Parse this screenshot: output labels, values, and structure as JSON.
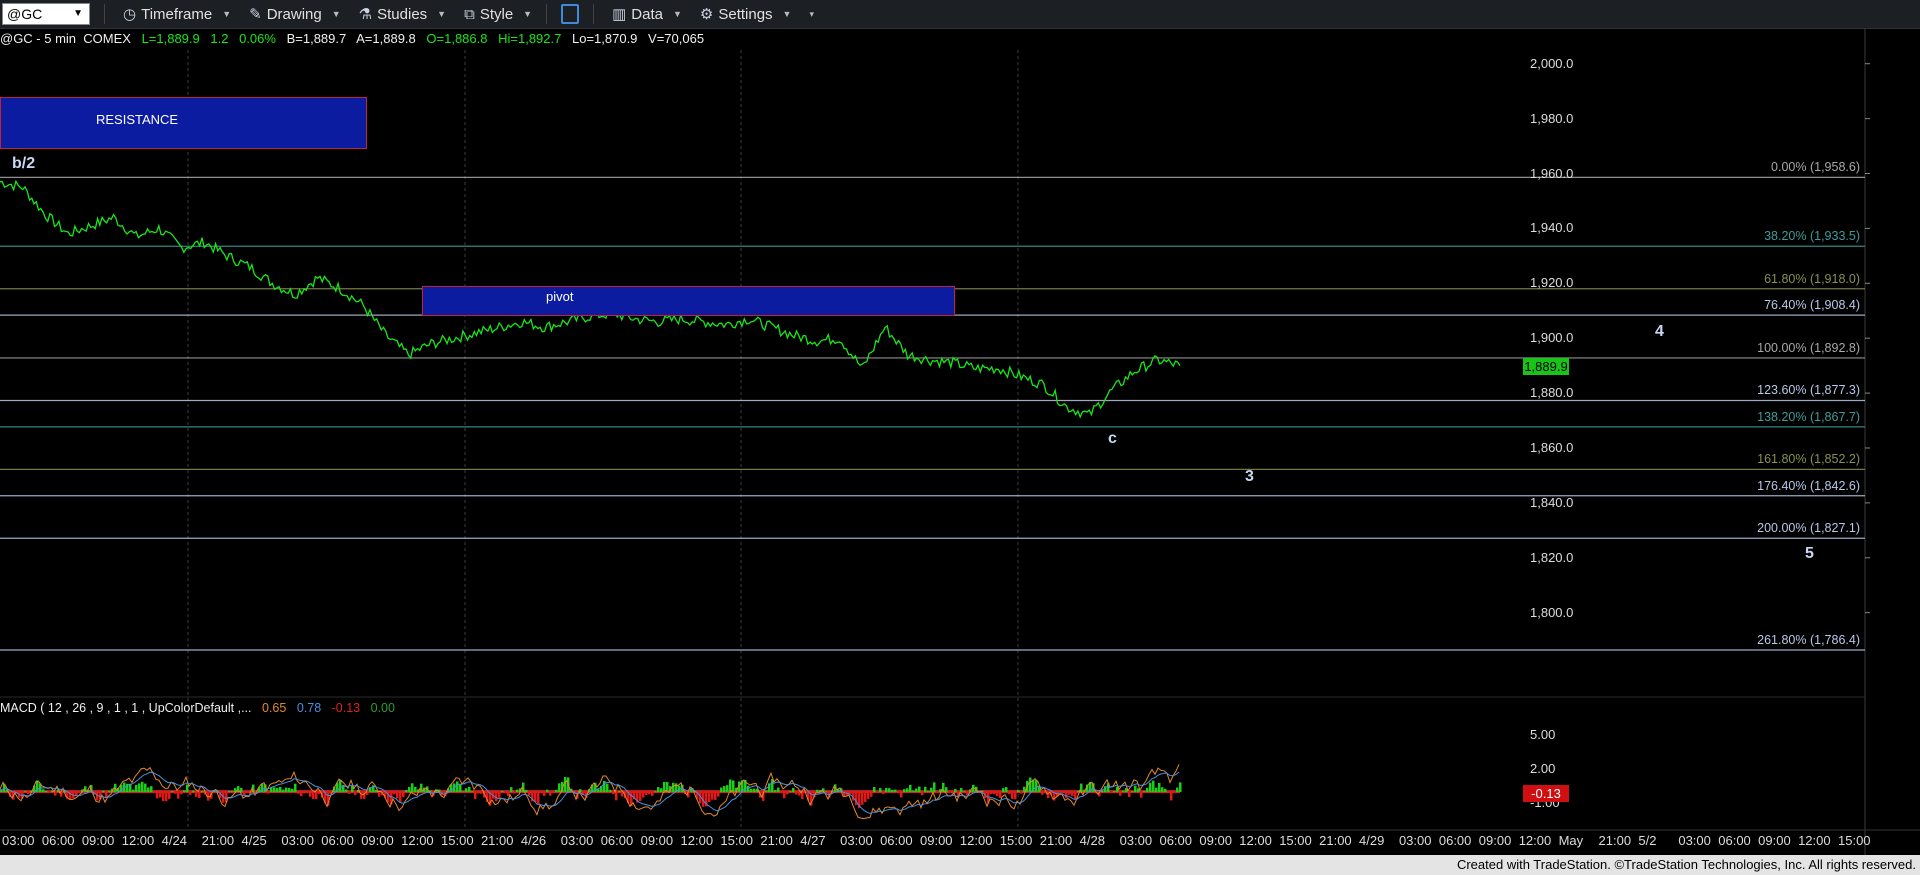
{
  "toolbar": {
    "symbol": "@GC",
    "timeframe": "Timeframe",
    "drawing": "Drawing",
    "studies": "Studies",
    "style": "Style",
    "data": "Data",
    "settings": "Settings"
  },
  "status": {
    "instrument": "@GC - 5 min  COMEX",
    "last": "L=1,889.9",
    "change": "1.2",
    "pct": "0.06%",
    "bid": "B=1,889.7",
    "ask": "A=1,889.8",
    "open": "O=1,886.8",
    "high": "Hi=1,892.7",
    "low": "Lo=1,870.9",
    "volume": "V=70,065"
  },
  "current_price": "1,889.9",
  "footer": "Created with TradeStation. ©TradeStation Technologies, Inc. All rights reserved.",
  "colors": {
    "price_line": "#19e619",
    "macd_hist_pos": "#19d019",
    "macd_hist_neg": "#e01818",
    "box_fill": "#0b1ca0",
    "box_border": "#c0223a"
  },
  "chart_data": [
    {
      "type": "line",
      "instrument": "@GC - 5 min COMEX",
      "ylim": [
        1770,
        2005
      ],
      "y_ticks": [
        "2,000.0",
        "1,980.0",
        "1,960.0",
        "1,940.0",
        "1,920.0",
        "1,900.0",
        "1,880.0",
        "1,860.0",
        "1,840.0",
        "1,820.0",
        "1,800.0"
      ],
      "x_ticks": [
        "03:00",
        "06:00",
        "09:00",
        "12:00",
        "4/24",
        "21:00",
        "4/25",
        "03:00",
        "06:00",
        "09:00",
        "12:00",
        "15:00",
        "21:00",
        "4/26",
        "03:00",
        "06:00",
        "09:00",
        "12:00",
        "15:00",
        "21:00",
        "4/27",
        "03:00",
        "06:00",
        "09:00",
        "12:00",
        "15:00",
        "21:00",
        "4/28",
        "03:00",
        "06:00",
        "09:00",
        "12:00",
        "15:00",
        "21:00",
        "4/29",
        "03:00",
        "06:00",
        "09:00",
        "12:00",
        "May",
        "21:00",
        "5/2",
        "03:00",
        "06:00",
        "09:00",
        "12:00",
        "15:00"
      ],
      "series": [
        {
          "values": [
            1957,
            1955,
            1945,
            1938,
            1941,
            1944,
            1937,
            1940,
            1933,
            1935,
            1930,
            1926,
            1920,
            1916,
            1922,
            1918,
            1912,
            1901,
            1894,
            1898,
            1900,
            1902,
            1904,
            1906,
            1904,
            1906,
            1908,
            1909,
            1907,
            1906,
            1907,
            1906,
            1905,
            1907,
            1904,
            1901,
            1899,
            1900,
            1889,
            1904,
            1894,
            1892,
            1891,
            1889,
            1889,
            1886,
            1883,
            1875,
            1872,
            1881,
            1888,
            1892,
            1890
          ]
        }
      ],
      "fib_levels": [
        {
          "label": "0.00% (1,958.6)",
          "value": 1958.6,
          "color": "#a8a8a8"
        },
        {
          "label": "38.20% (1,933.5)",
          "value": 1933.5,
          "color": "#3f9c9a"
        },
        {
          "label": "61.80% (1,918.0)",
          "value": 1918.0,
          "color": "#8a9050"
        },
        {
          "label": "76.40% (1,908.4)",
          "value": 1908.4,
          "color": "#b8c8e8"
        },
        {
          "label": "100.00% (1,892.8)",
          "value": 1892.8,
          "color": "#a8a8a8"
        },
        {
          "label": "123.60% (1,877.3)",
          "value": 1877.3,
          "color": "#b8c8e8"
        },
        {
          "label": "138.20% (1,867.7)",
          "value": 1867.7,
          "color": "#3f9c9a"
        },
        {
          "label": "161.80% (1,852.2)",
          "value": 1852.2,
          "color": "#8a9050"
        },
        {
          "label": "176.40% (1,842.6)",
          "value": 1842.6,
          "color": "#b8c8e8"
        },
        {
          "label": "200.00% (1,827.1)",
          "value": 1827.1,
          "color": "#b8c8e8"
        },
        {
          "label": "261.80% (1,786.4)",
          "value": 1786.4,
          "color": "#b8c8e8"
        }
      ],
      "boxes": [
        {
          "label": "RESISTANCE",
          "top": 1988,
          "bottom": 1969
        },
        {
          "label": "pivot",
          "top": 1919,
          "bottom": 1908
        }
      ],
      "wave_labels": [
        {
          "label": "b/2",
          "value": 1963
        },
        {
          "label": "c",
          "value": 1863
        },
        {
          "label": "3",
          "value": 1849
        },
        {
          "label": "4",
          "value": 1902
        },
        {
          "label": "5",
          "value": 1821
        }
      ]
    },
    {
      "type": "bar",
      "title": "MACD ( 12 , 26 , 9 , 1 , 1 , UpColorDefault ,...",
      "values_legend": [
        "0.65",
        "0.78",
        "-0.13",
        "0.00"
      ],
      "ylim": [
        -3.2,
        7
      ],
      "y_ticks": [
        "5.00",
        "2.00",
        "-1.00"
      ],
      "current_value": "-0.13"
    }
  ]
}
